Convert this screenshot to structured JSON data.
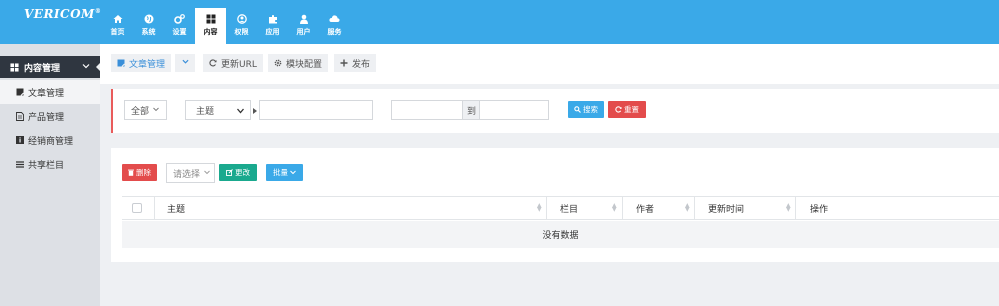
{
  "brand": {
    "logo_text": "VERICOM",
    "logo_mark": "®"
  },
  "colors": {
    "topbar": "#3aa9e8",
    "sidebar_head": "#2f3640",
    "primary": "#3aa9e8",
    "danger": "#e34c4c",
    "success": "#1aa98e",
    "accent_border": "#e95b5b"
  },
  "nav": [
    {
      "label": "首页",
      "icon": "home-icon"
    },
    {
      "label": "系统",
      "icon": "globe-icon"
    },
    {
      "label": "设置",
      "icon": "cogs-icon"
    },
    {
      "label": "内容",
      "icon": "grid-icon",
      "active": true
    },
    {
      "label": "权限",
      "icon": "user-circle-icon"
    },
    {
      "label": "应用",
      "icon": "puzzle-icon"
    },
    {
      "label": "用户",
      "icon": "user-icon"
    },
    {
      "label": "服务",
      "icon": "cloud-icon"
    }
  ],
  "sidebar": {
    "header": "内容管理",
    "items": [
      {
        "label": "文章管理",
        "icon": "doc-icon",
        "active": true
      },
      {
        "label": "产品管理",
        "icon": "file-icon"
      },
      {
        "label": "经销商管理",
        "icon": "info-icon"
      },
      {
        "label": "共享栏目",
        "icon": "list-icon"
      }
    ]
  },
  "tabs": {
    "article": "文章管理",
    "refresh": "更新URL",
    "module": "模块配置",
    "publish": "发布"
  },
  "filter": {
    "scope": "全部",
    "field": "主题",
    "to_label": "到",
    "search": "搜索",
    "reset": "重置"
  },
  "toolbar": {
    "delete": "删除",
    "select": "请选择",
    "edit": "更改",
    "batch": "批量"
  },
  "table": {
    "columns": [
      "主题",
      "栏目",
      "作者",
      "更新时间",
      "操作"
    ],
    "empty_text": "没有数据"
  }
}
